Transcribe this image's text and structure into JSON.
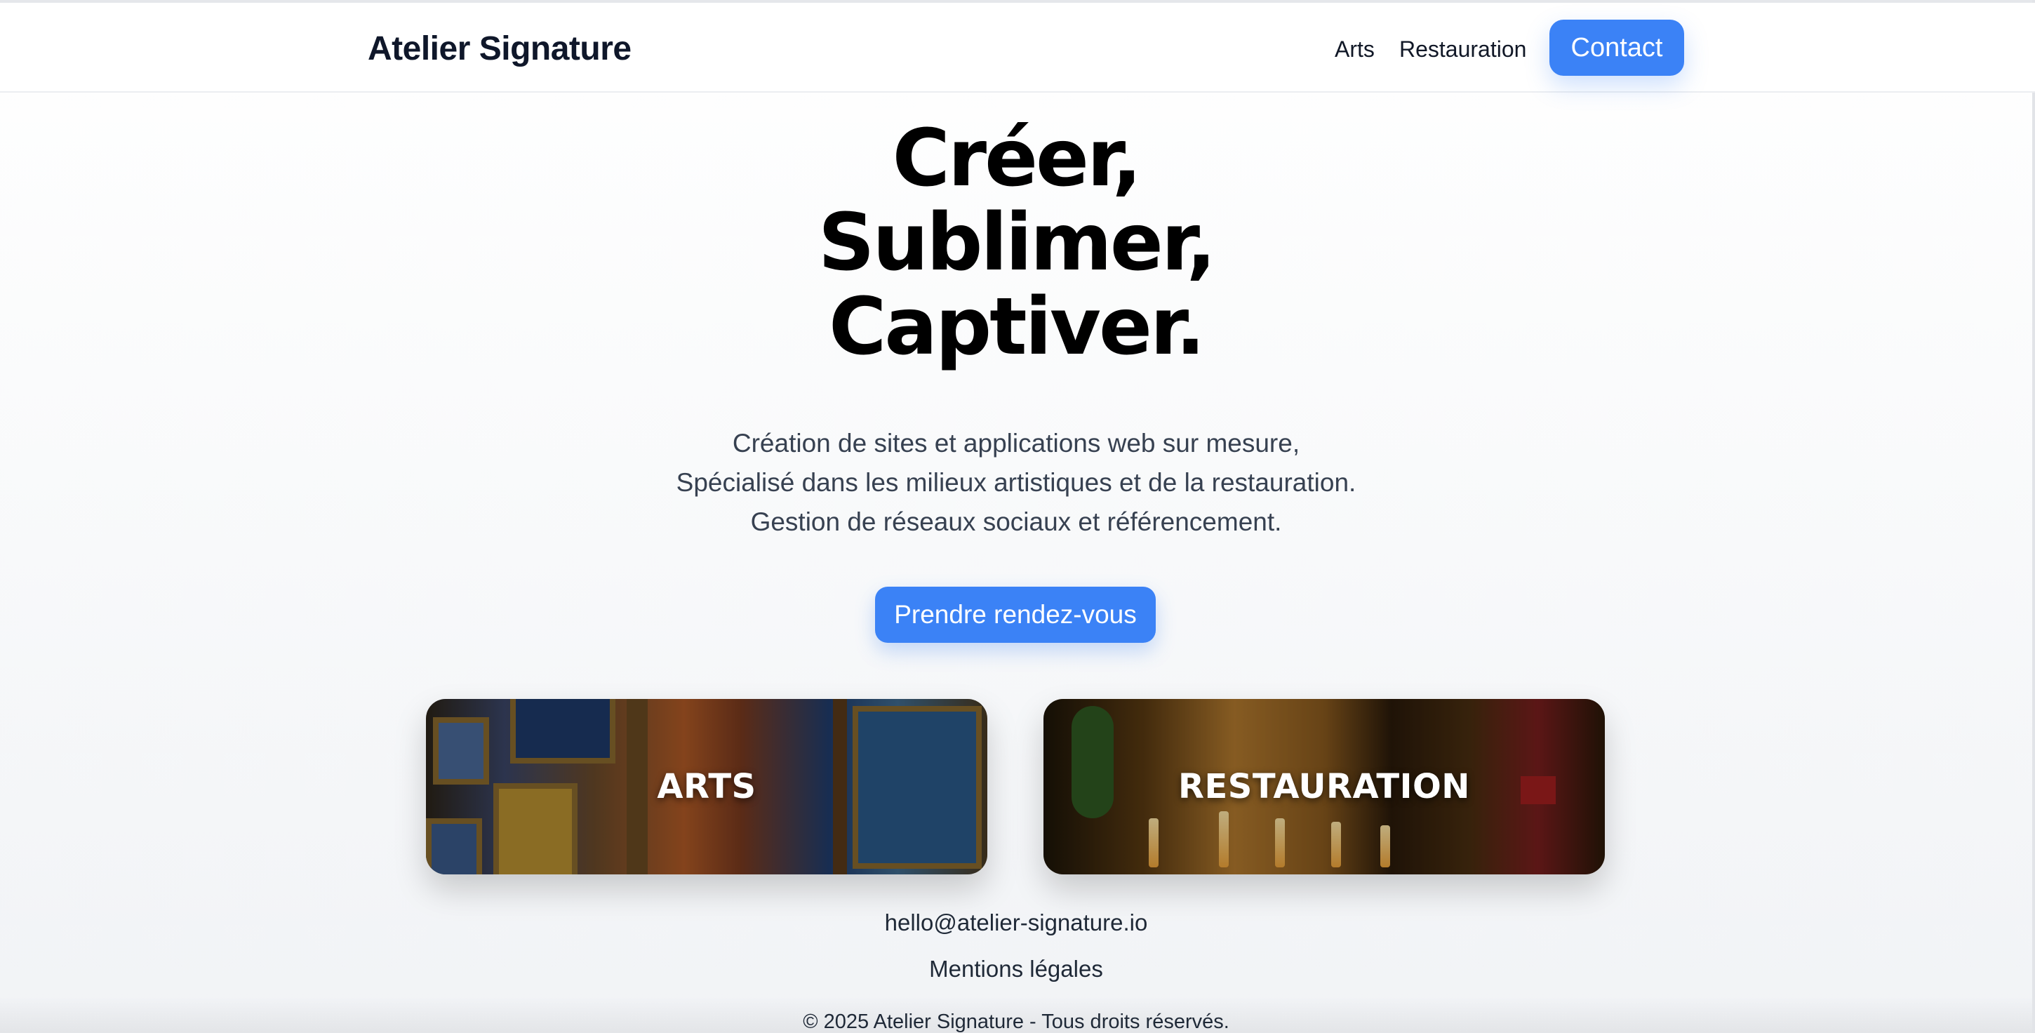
{
  "header": {
    "brand": "Atelier Signature",
    "nav": {
      "arts": "Arts",
      "restauration": "Restauration",
      "contact": "Contact"
    }
  },
  "hero": {
    "title_lines": [
      "Créer,",
      "Sublimer,",
      "Captiver."
    ],
    "subtitle_lines": [
      "Création de sites et applications web sur mesure,",
      "Spécialisé dans les milieux artistiques et de la restauration.",
      "Gestion de réseaux sociaux et référencement."
    ],
    "cta": "Prendre rendez-vous"
  },
  "cards": [
    {
      "label": "ARTS"
    },
    {
      "label": "RESTAURATION"
    }
  ],
  "footer": {
    "email": "hello@atelier-signature.io",
    "legal": "Mentions légales",
    "copyright": "© 2025 Atelier Signature - Tous droits réservés."
  },
  "colors": {
    "accent": "#3b82f6",
    "text": "#111827",
    "background": "#f9fafb"
  }
}
